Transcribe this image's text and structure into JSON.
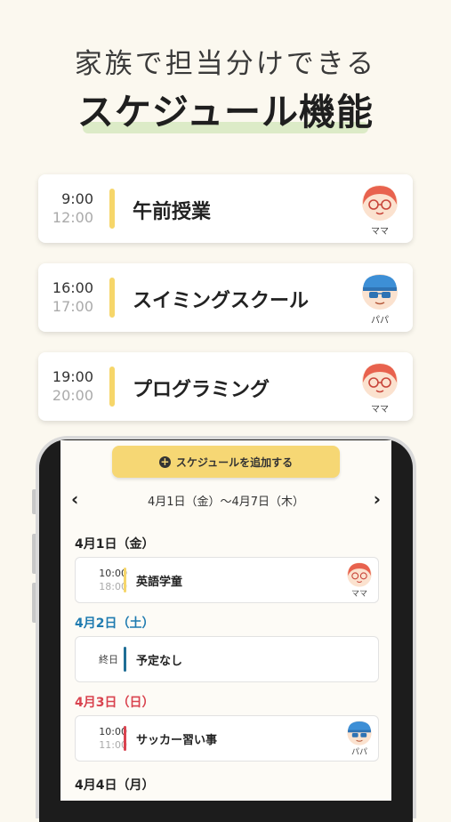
{
  "header": {
    "subtitle": "家族で担当分けできる",
    "title": "スケジュール機能"
  },
  "cards": [
    {
      "start": "9:00",
      "end": "12:00",
      "name": "午前授業",
      "role": "ママ",
      "bar_color": "#f6d66a"
    },
    {
      "start": "16:00",
      "end": "17:00",
      "name": "スイミングスクール",
      "role": "パパ",
      "bar_color": "#f6d66a"
    },
    {
      "start": "19:00",
      "end": "20:00",
      "name": "プログラミング",
      "role": "ママ",
      "bar_color": "#f6d66a"
    }
  ],
  "phone": {
    "add_button_label": "スケジュールを追加する",
    "add_icon": "plus-icon",
    "week_range": "4月1日（金）〜4月7日（木）",
    "prev_icon": "chevron-left-icon",
    "next_icon": "chevron-right-icon",
    "days": [
      {
        "label": "4月1日（金）",
        "color": "#222222",
        "item": {
          "start": "10:00",
          "end": "18:00",
          "name": "英語学童",
          "role": "ママ",
          "bar_color": "#f6d66a"
        }
      },
      {
        "label": "4月2日（土）",
        "color": "#1f7bb0",
        "item": {
          "allday": "終日",
          "name": "予定なし",
          "bar_color": "#1f6e96"
        }
      },
      {
        "label": "4月3日（日）",
        "color": "#d9434f",
        "item": {
          "start": "10:00",
          "end": "11:00",
          "name": "サッカー習い事",
          "role": "パパ",
          "bar_color": "#d9434f"
        }
      },
      {
        "label": "4月4日（月）",
        "color": "#222222"
      }
    ]
  },
  "colors": {
    "background": "#fbf8ef",
    "accent_yellow": "#f6d774",
    "mama_hair": "#e8624e",
    "papa_cap": "#3d8fd6"
  }
}
